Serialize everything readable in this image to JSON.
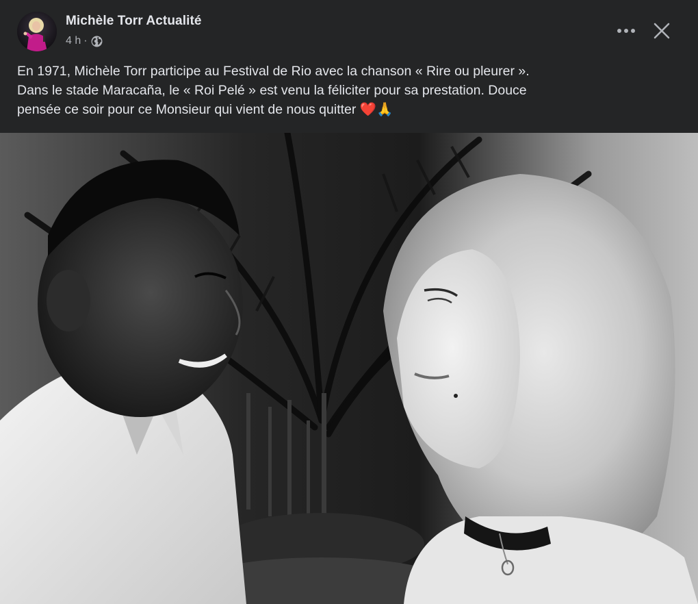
{
  "post": {
    "page_name": "Michèle Torr Actualité",
    "time": "4 h",
    "separator": "·",
    "privacy_icon": "globe-icon",
    "more_icon": "more-horizontal-icon",
    "close_icon": "close-icon",
    "text_lines": [
      "En 1971, Michèle Torr participe au Festival de Rio avec la chanson « Rire ou pleurer ».",
      "Dans le stade Maracaña, le « Roi Pelé » est venu la féliciter pour sa prestation. Douce",
      "pensée ce soir pour ce Monsieur qui vient de nous quitter ❤️🙏"
    ]
  },
  "colors": {
    "background": "#242526",
    "primary_text": "#e4e6eb",
    "secondary_text": "#b0b3b8",
    "heart": "#e0245e"
  }
}
